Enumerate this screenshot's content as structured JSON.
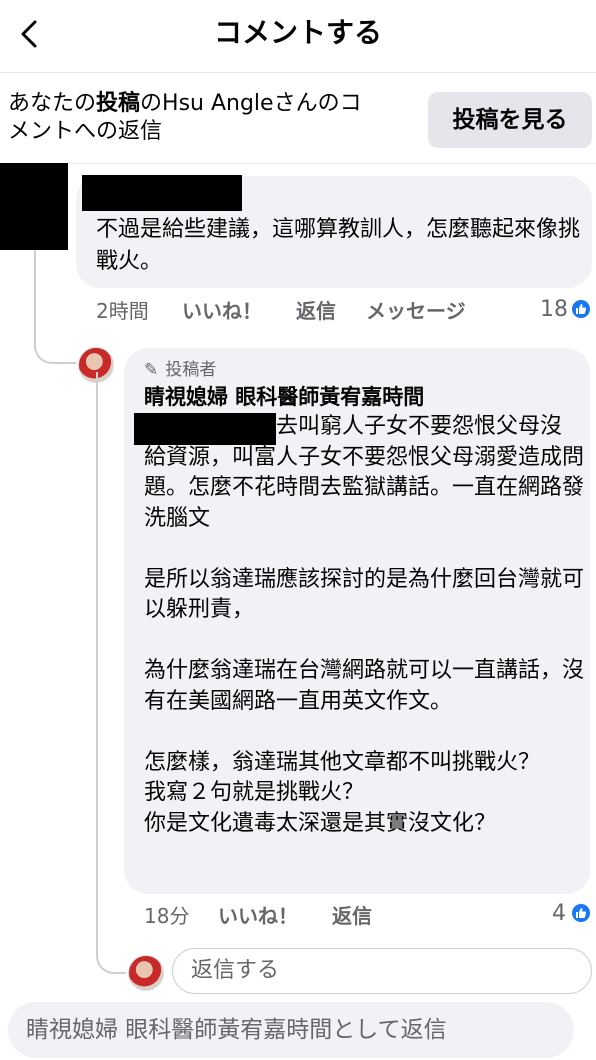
{
  "header": {
    "title": "コメントする"
  },
  "context": {
    "prefix": "あなたの",
    "bold_word": "投稿",
    "middle": "のHsu Angleさんのコ",
    "line2": "メントへの返信",
    "view_post_label": "投稿を見る"
  },
  "comment1": {
    "text": "不過是給些建議，這哪算教訓人，怎麼聽起來像挑戰火。",
    "actions": {
      "time": "2時間",
      "like": "いいね！",
      "reply": "返信",
      "message": "メッセージ"
    },
    "like_count": "18"
  },
  "reply": {
    "badge": "投稿者",
    "author": "睛視媳婦 眼科醫師黃宥嘉時間",
    "text_first": "去叫窮人子女不要怨恨父",
    "text_rest": "母沒給資源，叫富人子女不要怨恨父母溺愛造成問題。怎麼不花時間去監獄講話。一直在網路發洗腦文\n\n是所以翁達瑞應該探討的是為什麼回台灣就可以躲刑責，\n\n為什麼翁達瑞在台灣網路就可以一直講話，沒有在美國網路一直用英文作文。\n\n怎麼樣，翁達瑞其他文章都不叫挑戰火？\n我寫２句就是挑戰火？\n你是文化遺毒太深還是其實沒文化？",
    "actions": {
      "time": "18分",
      "like": "いいね！",
      "reply": "返信"
    },
    "like_count": "4"
  },
  "reply_input": {
    "placeholder": "返信する"
  },
  "composer": {
    "placeholder": "睛視媳婦 眼科醫師黃宥嘉時間として返信"
  },
  "colors": {
    "accent": "#1877f2",
    "bubble": "#f0f2f5",
    "muted": "#65676b"
  }
}
